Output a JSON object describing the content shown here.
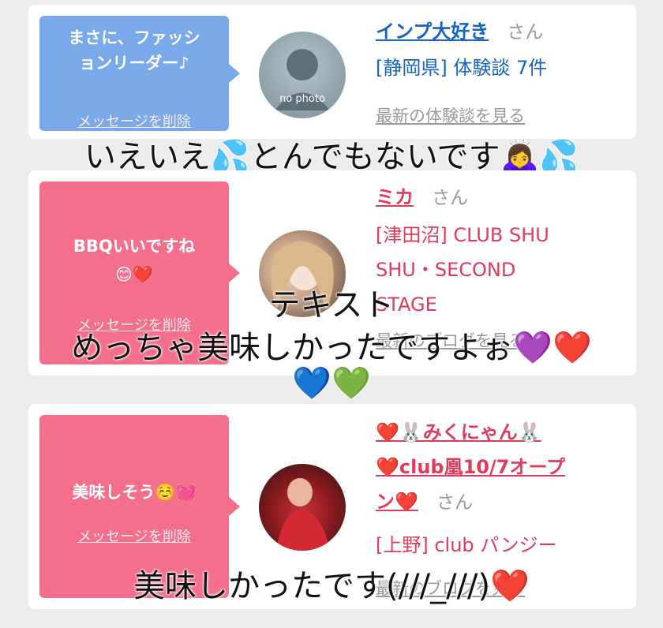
{
  "cards": [
    {
      "message": "まさに、ファッションリーダー♪",
      "message_line1": "まさに、ファッシ",
      "message_line2": "ョンリーダー♪",
      "delete_label": "メッセージを削除",
      "avatar": "no photo",
      "name": "インプ大好き",
      "honorific": "さん",
      "detail": "[静岡県] 体験談 7件",
      "link": "最新の体験談を見る",
      "bubble_color": "#7aa9ea"
    },
    {
      "message_line1": "BBQいいですね",
      "message_line2": "😊❤️",
      "delete_label": "メッセージを削除",
      "name": "ミカ",
      "honorific": "さん",
      "detail_line1": "[津田沼] CLUB SHU",
      "detail_line2": "SHU・SECOND",
      "detail_line3": "STAGE",
      "link": "最新のブログを見る",
      "bubble_color": "#f36f8b"
    },
    {
      "message_line1": "美味しそう☺️💓",
      "delete_label": "メッセージを削除",
      "name_line1": "❤️🐰みくにゃん🐰",
      "name_line2": "❤️club凰10/7オープ",
      "name_line3": "ン❤️",
      "honorific": "さん",
      "detail": "[上野] club パンジー",
      "link": "最新のブログを見る",
      "bubble_color": "#f36f8b"
    }
  ],
  "captions": {
    "c1": "いえいえ💦とんでもないです🙇‍♀️💦",
    "c2a": "テキスト",
    "c2b": "めっちゃ美味しかったですよぉ💜❤️",
    "c2c": "💙💚",
    "c3": "美味しかったです(///_///)❤️"
  },
  "colors": {
    "accent_blue": "#1565c0",
    "accent_pink": "#e03a5c",
    "muted": "#999999"
  }
}
